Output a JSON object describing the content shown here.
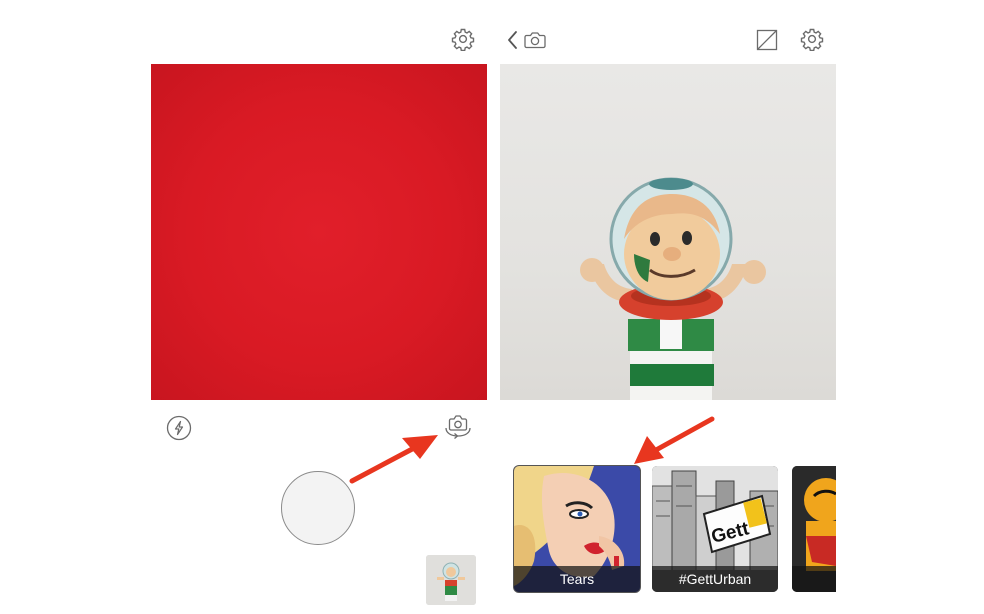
{
  "left_panel": {
    "settings_icon": "gear-icon",
    "flash_icon": "lightning-icon",
    "switch_camera_icon": "camera-switch-icon"
  },
  "right_panel": {
    "back_icon": "chevron-left-icon",
    "camera_icon": "camera-icon",
    "compare_icon": "split-square-icon",
    "settings_icon": "gear-icon"
  },
  "filters": [
    {
      "label": "Tears"
    },
    {
      "label": "#GettUrban"
    },
    {
      "label": ""
    }
  ],
  "colors": {
    "viewfinder_red": "#dc1c26",
    "annotation_arrow": "#e8361f"
  }
}
